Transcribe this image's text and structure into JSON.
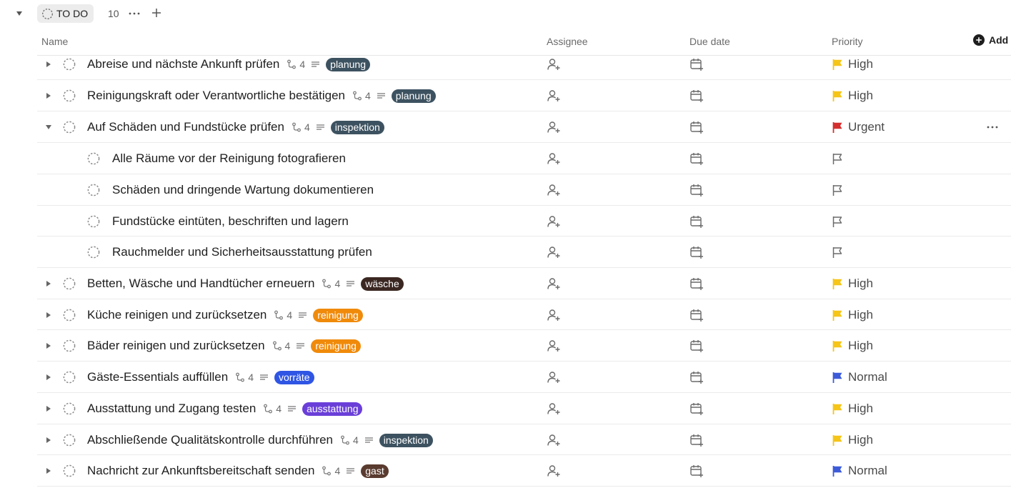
{
  "group": {
    "status_label": "TO DO",
    "count": "10"
  },
  "columns": {
    "name": "Name",
    "assignee": "Assignee",
    "due_date": "Due date",
    "priority": "Priority",
    "add": "Add"
  },
  "colors": {
    "flag_high": "#f5c518",
    "flag_urgent": "#d32f2f",
    "flag_normal": "#3d5bd8",
    "tag_planung": "#3d5260",
    "tag_inspektion": "#3d5260",
    "tag_waesche": "#3b2722",
    "tag_reinigung": "#f08a0a",
    "tag_vorraete": "#2f55e4",
    "tag_ausstattung": "#6a3fd8",
    "tag_gast": "#5a3b2f"
  },
  "tasks": [
    {
      "name": "Abreise und nächste Ankunft prüfen",
      "subtasks": "4",
      "tag": "planung",
      "priority": "High"
    },
    {
      "name": "Reinigungskraft oder Verantwortliche bestätigen",
      "subtasks": "4",
      "tag": "planung",
      "priority": "High"
    },
    {
      "name": "Auf Schäden und Fundstücke prüfen",
      "subtasks": "4",
      "tag": "inspektion",
      "priority": "Urgent",
      "expanded": true
    },
    {
      "name": "Alle Räume vor der Reinigung fotografieren",
      "subtask": true
    },
    {
      "name": "Schäden und dringende Wartung dokumentieren",
      "subtask": true
    },
    {
      "name": "Fundstücke eintüten, beschriften und lagern",
      "subtask": true
    },
    {
      "name": "Rauchmelder und Sicherheitsausstattung prüfen",
      "subtask": true
    },
    {
      "name": "Betten, Wäsche und Handtücher erneuern",
      "subtasks": "4",
      "tag": "wäsche",
      "priority": "High"
    },
    {
      "name": "Küche reinigen und zurücksetzen",
      "subtasks": "4",
      "tag": "reinigung",
      "priority": "High"
    },
    {
      "name": "Bäder reinigen und zurücksetzen",
      "subtasks": "4",
      "tag": "reinigung",
      "priority": "High"
    },
    {
      "name": "Gäste-Essentials auffüllen",
      "subtasks": "4",
      "tag": "vorräte",
      "priority": "Normal"
    },
    {
      "name": "Ausstattung und Zugang testen",
      "subtasks": "4",
      "tag": "ausstattung",
      "priority": "High"
    },
    {
      "name": "Abschließende Qualitätskontrolle durchführen",
      "subtasks": "4",
      "tag": "inspektion",
      "priority": "High"
    },
    {
      "name": "Nachricht zur Ankunftsbereitschaft senden",
      "subtasks": "4",
      "tag": "gast",
      "priority": "Normal"
    }
  ]
}
